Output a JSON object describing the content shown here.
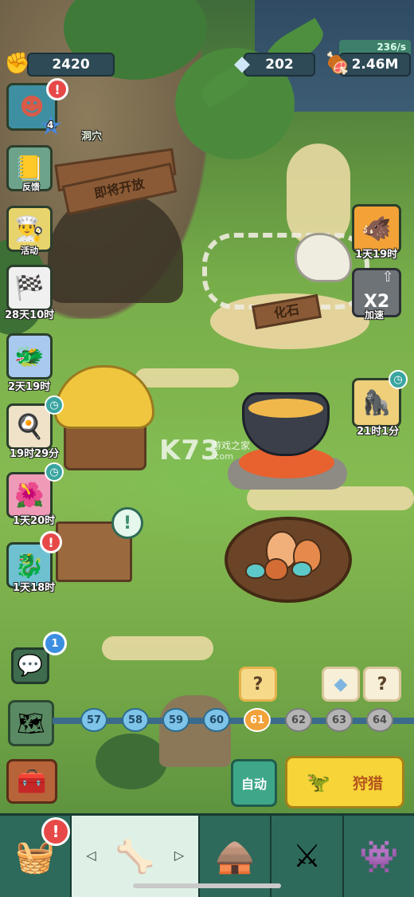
{
  "hud": {
    "fist_count": "2420",
    "crystal_count": "202",
    "meat_rate": "236/s",
    "meat_total": "2.46M"
  },
  "profile": {
    "level": "4",
    "location_label": "洞穴"
  },
  "cave_sign": "即将开放",
  "fossil_sign": "化石",
  "side_menu": [
    {
      "id": "feedback",
      "label": "反馈",
      "icon": "notebook-icon"
    },
    {
      "id": "event",
      "label": "活动",
      "icon": "caveman-chef-icon"
    },
    {
      "id": "race",
      "label": "28天10时",
      "icon": "checkered-flag-icon"
    },
    {
      "id": "dragon",
      "label": "2天19时",
      "icon": "blue-dragon-icon"
    },
    {
      "id": "chef",
      "label": "19时29分",
      "icon": "chef-dino-icon"
    },
    {
      "id": "flower",
      "label": "1天20时",
      "icon": "flower-monster-icon"
    },
    {
      "id": "sea-dragon",
      "label": "1天18时",
      "icon": "sea-dragon-icon"
    }
  ],
  "right_menu": {
    "pig_timer": "1天19时",
    "speed_label": "加速",
    "speed_value": "X2",
    "ape_timer": "21时1分"
  },
  "watermark": {
    "logo": "K73",
    "cn": "游戏之家",
    "url": ".com"
  },
  "chat_badge": "1",
  "levels": [
    {
      "n": "57",
      "state": "done"
    },
    {
      "n": "58",
      "state": "done"
    },
    {
      "n": "59",
      "state": "done"
    },
    {
      "n": "60",
      "state": "done"
    },
    {
      "n": "61",
      "state": "current"
    },
    {
      "n": "62",
      "state": "locked"
    },
    {
      "n": "63",
      "state": "locked"
    },
    {
      "n": "64",
      "state": "locked"
    }
  ],
  "rewards": {
    "r61": "?",
    "r63_icon": "crystal-icon",
    "r64": "?"
  },
  "buttons": {
    "auto": "自动",
    "hunt": "狩猎"
  },
  "alerts": {
    "mark": "!"
  },
  "colors": {
    "accent_green": "#3ea78a",
    "hunt_yellow": "#f7d437",
    "alert_red": "#e74949",
    "level_done": "#7ec3e8",
    "level_current": "#f2a23a"
  }
}
